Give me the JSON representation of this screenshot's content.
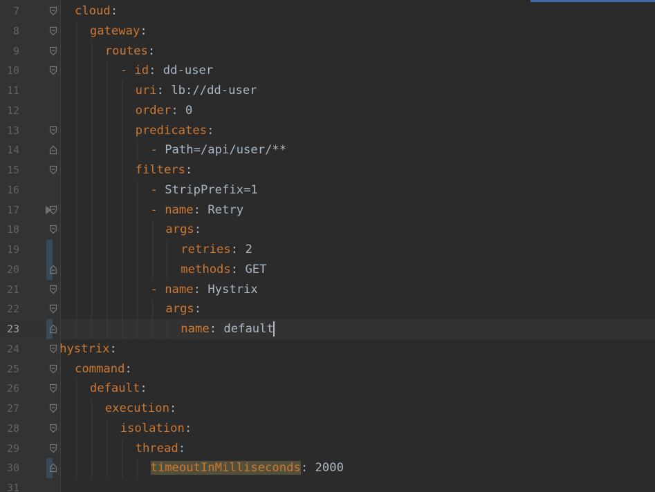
{
  "editor": {
    "current_line": 23,
    "lines": [
      {
        "n": "7",
        "indent": 0,
        "dash": "",
        "key": "cloud",
        "colon": ":",
        "value": ""
      },
      {
        "n": "8",
        "indent": 1,
        "dash": "",
        "key": "gateway",
        "colon": ":",
        "value": ""
      },
      {
        "n": "9",
        "indent": 2,
        "dash": "",
        "key": "routes",
        "colon": ":",
        "value": ""
      },
      {
        "n": "10",
        "indent": 3,
        "dash": "- ",
        "key": "id",
        "colon": ":",
        "value": " dd-user"
      },
      {
        "n": "11",
        "indent": 4,
        "dash": "",
        "key": "uri",
        "colon": ":",
        "value": " lb://dd-user"
      },
      {
        "n": "12",
        "indent": 4,
        "dash": "",
        "key": "order",
        "colon": ":",
        "value": " 0"
      },
      {
        "n": "13",
        "indent": 4,
        "dash": "",
        "key": "predicates",
        "colon": ":",
        "value": ""
      },
      {
        "n": "14",
        "indent": 5,
        "dash": "- ",
        "key": "",
        "colon": "",
        "value": "Path=/api/user/**"
      },
      {
        "n": "15",
        "indent": 4,
        "dash": "",
        "key": "filters",
        "colon": ":",
        "value": ""
      },
      {
        "n": "16",
        "indent": 5,
        "dash": "- ",
        "key": "",
        "colon": "",
        "value": "StripPrefix=1"
      },
      {
        "n": "17",
        "indent": 5,
        "dash": "- ",
        "key": "name",
        "colon": ":",
        "value": " Retry"
      },
      {
        "n": "18",
        "indent": 6,
        "dash": "",
        "key": "args",
        "colon": ":",
        "value": ""
      },
      {
        "n": "19",
        "indent": 7,
        "dash": "",
        "key": "retries",
        "colon": ":",
        "value": " 2"
      },
      {
        "n": "20",
        "indent": 7,
        "dash": "",
        "key": "methods",
        "colon": ":",
        "value": " GET"
      },
      {
        "n": "21",
        "indent": 5,
        "dash": "- ",
        "key": "name",
        "colon": ":",
        "value": " Hystrix"
      },
      {
        "n": "22",
        "indent": 6,
        "dash": "",
        "key": "args",
        "colon": ":",
        "value": ""
      },
      {
        "n": "23",
        "indent": 7,
        "dash": "",
        "key": "name",
        "colon": ":",
        "value": " default"
      },
      {
        "n": "24",
        "indent": -1,
        "dash": "",
        "key": "hystrix",
        "colon": ":",
        "value": ""
      },
      {
        "n": "25",
        "indent": 0,
        "dash": "",
        "key": "command",
        "colon": ":",
        "value": ""
      },
      {
        "n": "26",
        "indent": 1,
        "dash": "",
        "key": "default",
        "colon": ":",
        "value": ""
      },
      {
        "n": "27",
        "indent": 2,
        "dash": "",
        "key": "execution",
        "colon": ":",
        "value": ""
      },
      {
        "n": "28",
        "indent": 3,
        "dash": "",
        "key": "isolation",
        "colon": ":",
        "value": ""
      },
      {
        "n": "29",
        "indent": 4,
        "dash": "",
        "key": "thread",
        "colon": ":",
        "value": ""
      },
      {
        "n": "30",
        "indent": 5,
        "dash": "",
        "key": "timeoutInMilliseconds",
        "colon": ":",
        "value": " 2000"
      },
      {
        "n": "31",
        "indent": 0,
        "dash": "",
        "key": "",
        "colon": "",
        "value": ""
      }
    ]
  },
  "colors": {
    "background": "#2b2b2b",
    "gutter": "#313335",
    "key": "#cc7832",
    "value": "#a9b7c6",
    "line_number": "#606366",
    "current_line": "#323232",
    "highlight": "#52503a"
  }
}
